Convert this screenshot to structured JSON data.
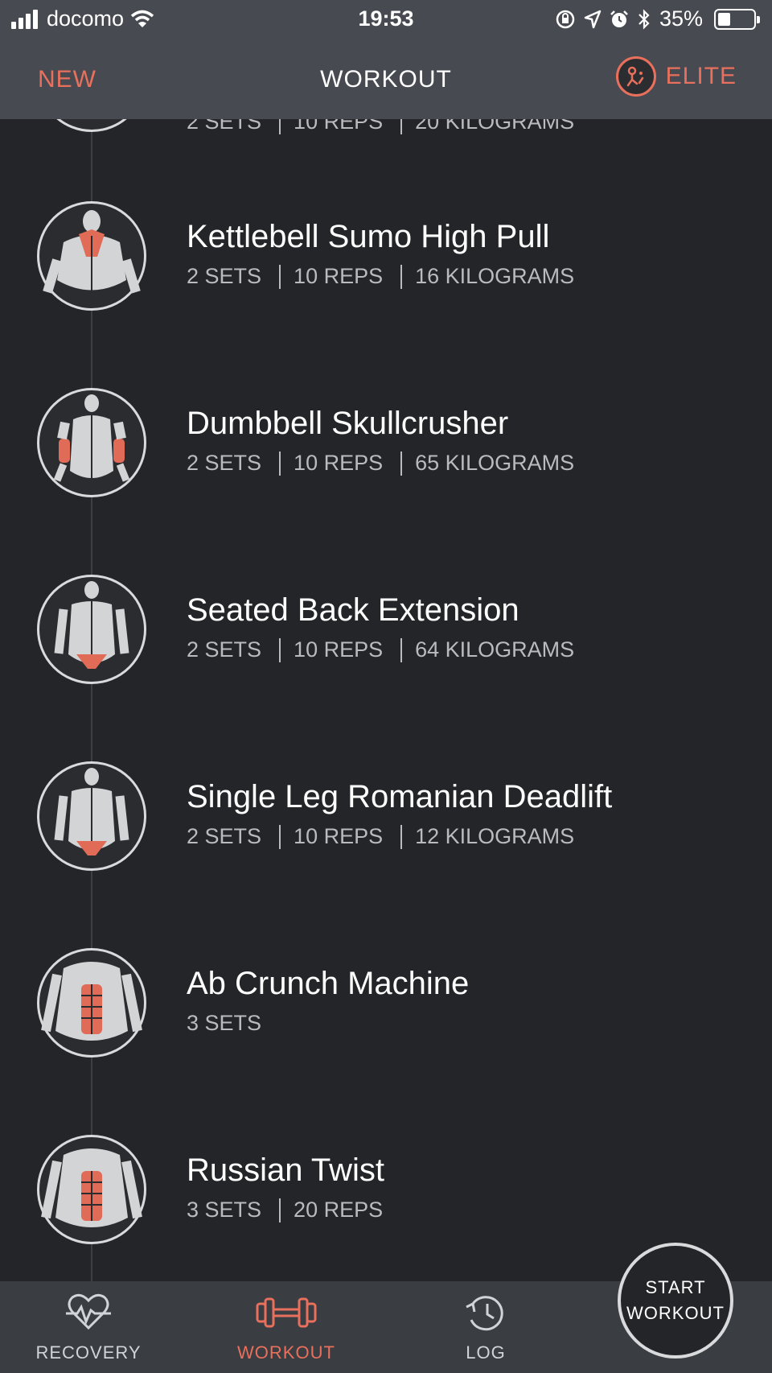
{
  "status_bar": {
    "carrier": "docomo",
    "time": "19:53",
    "battery_percent": "35%",
    "battery_level": 0.35
  },
  "nav": {
    "left": "NEW",
    "title": "WORKOUT",
    "right": "ELITE"
  },
  "partial_row": {
    "sets": "2 SETS",
    "reps": "10 REPS",
    "weight": "20 KILOGRAMS"
  },
  "exercises": [
    {
      "name": "Kettlebell Sumo High Pull",
      "sets": "2 SETS",
      "reps": "10 REPS",
      "weight": "16 KILOGRAMS",
      "icon": "back-traps-icon"
    },
    {
      "name": "Dumbbell Skullcrusher",
      "sets": "2 SETS",
      "reps": "10 REPS",
      "weight": "65 KILOGRAMS",
      "icon": "back-triceps-icon"
    },
    {
      "name": "Seated Back Extension",
      "sets": "2 SETS",
      "reps": "10 REPS",
      "weight": "64 KILOGRAMS",
      "icon": "back-lower-icon"
    },
    {
      "name": "Single Leg Romanian Deadlift",
      "sets": "2 SETS",
      "reps": "10 REPS",
      "weight": "12 KILOGRAMS",
      "icon": "back-lower-icon"
    },
    {
      "name": "Ab Crunch Machine",
      "sets": "3 SETS",
      "icon": "front-abs-icon"
    },
    {
      "name": "Russian Twist",
      "sets": "3 SETS",
      "reps": "20 REPS",
      "icon": "front-abs-icon"
    }
  ],
  "tabs": [
    {
      "label": "RECOVERY",
      "icon": "heart-pulse-icon",
      "active": false
    },
    {
      "label": "WORKOUT",
      "icon": "dumbbell-icon",
      "active": true
    },
    {
      "label": "LOG",
      "icon": "clock-history-icon",
      "active": false
    }
  ],
  "start_button": {
    "line1": "START",
    "line2": "WORKOUT"
  },
  "colors": {
    "accent": "#e8705c",
    "background": "#232529",
    "header": "#474a50",
    "tabbar": "#3a3d42"
  }
}
